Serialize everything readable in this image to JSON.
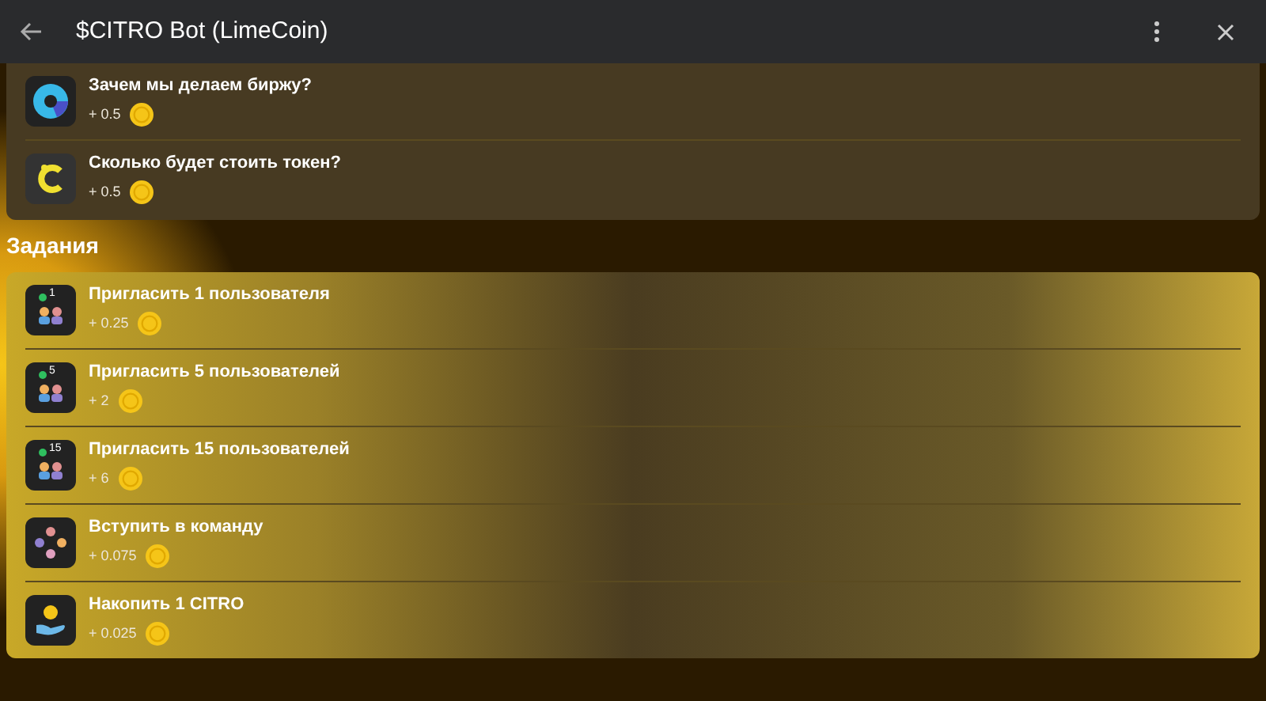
{
  "window": {
    "title": "$CITRO Bot (LimeCoin)"
  },
  "questions": [
    {
      "kind": "chart",
      "title": "Зачем мы делаем биржу?",
      "reward": "+ 0.5"
    },
    {
      "kind": "logo",
      "title": "Сколько будет стоить токен?",
      "reward": "+ 0.5"
    }
  ],
  "tasks_title": "Задания",
  "tasks": [
    {
      "kind": "invite",
      "badge": "1",
      "title": "Пригласить 1 пользователя",
      "reward": "+ 0.25"
    },
    {
      "kind": "invite",
      "badge": "5",
      "title": "Пригласить 5 пользователей",
      "reward": "+ 2"
    },
    {
      "kind": "invite",
      "badge": "15",
      "title": "Пригласить 15 пользователей",
      "reward": "+ 6"
    },
    {
      "kind": "team",
      "title": "Вступить в команду",
      "reward": "+ 0.075"
    },
    {
      "kind": "coin",
      "title": "Накопить 1 CITRO",
      "reward": "+ 0.025"
    }
  ]
}
